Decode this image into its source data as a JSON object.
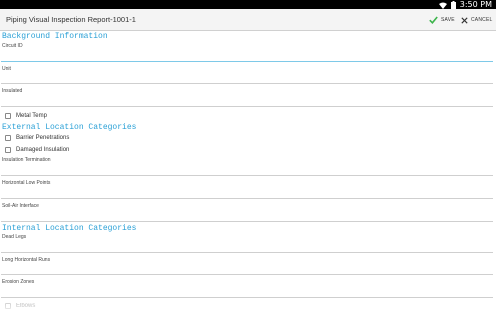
{
  "status_bar": {
    "time": "3:50 PM"
  },
  "action_bar": {
    "title": "Piping Visual Inspection Report-1001-1",
    "save_label": "SAVE",
    "cancel_label": "CANCEL"
  },
  "colors": {
    "accent": "#2aa0d6",
    "save_check": "#3cb44b"
  },
  "sections": {
    "background": "Background Information",
    "external": "External Location Categories",
    "internal": "Internal Location Categories"
  },
  "fields": {
    "circuit_id": "Circuit ID",
    "unit": "Unit",
    "insulated": "Insulated",
    "insulation_termination": "Insulation Termination",
    "horizontal_low_points": "Horizontal Low Points",
    "soil_air_interface": "Soil-Air Interface",
    "dead_legs": "Dead Legs",
    "long_horizontal_runs": "Long Horizontal Runs",
    "erosion_zones": "Erosion Zones"
  },
  "checkboxes": {
    "metal_temp": "Metal Temp",
    "barrier_penetrations": "Barrier Penetrations",
    "damaged_insulation": "Damaged Insulation",
    "elbows": "Elbows"
  }
}
